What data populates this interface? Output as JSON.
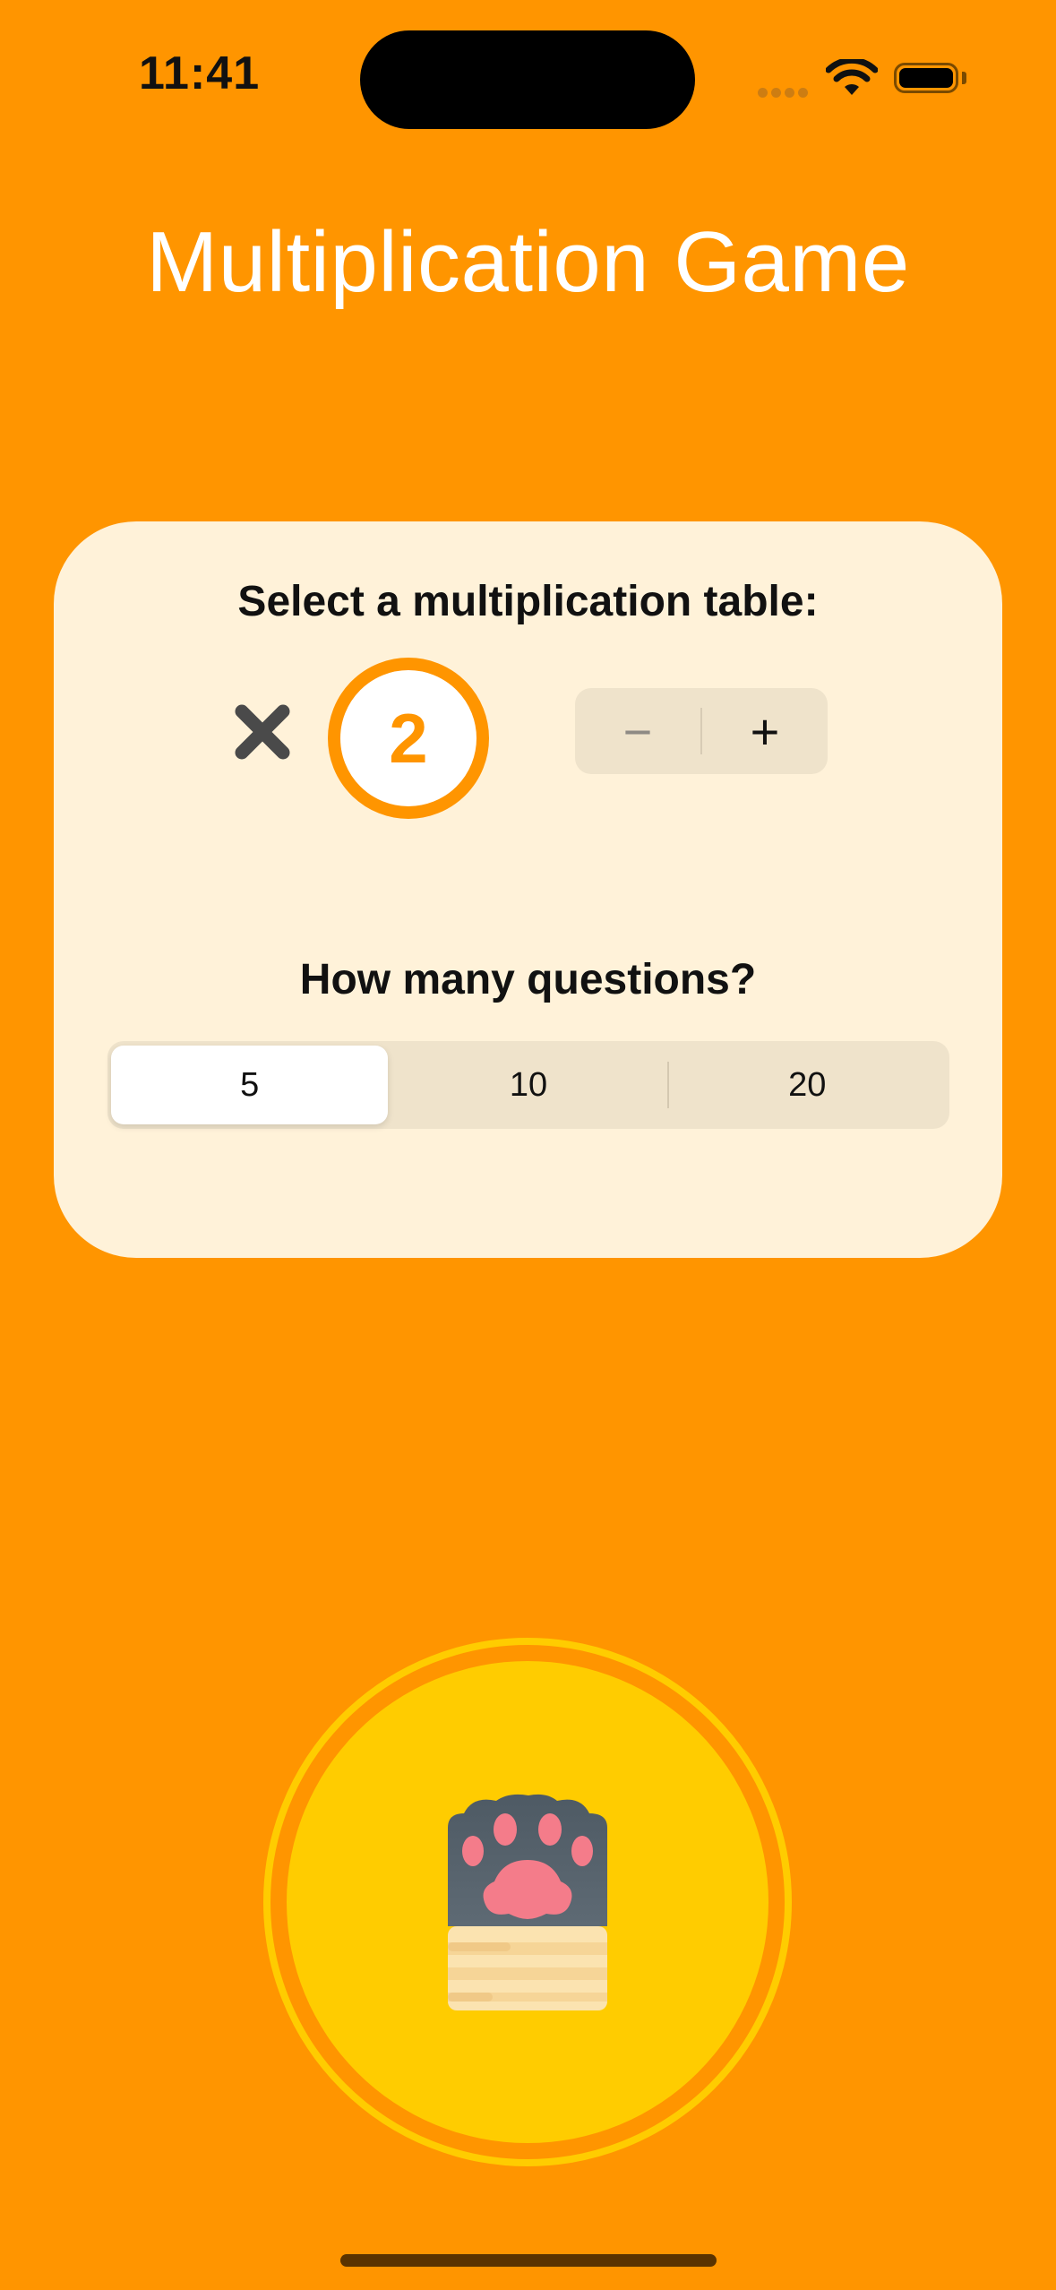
{
  "status_bar": {
    "time": "11:41"
  },
  "title": "Multiplication Game",
  "settings_card": {
    "table_prompt": "Select a multiplication table:",
    "times_symbol_icon": "multiply-icon",
    "selected_table": "2",
    "stepper": {
      "decrement_label": "−",
      "increment_label": "+"
    },
    "questions_prompt": "How many questions?",
    "question_options": [
      "5",
      "10",
      "20"
    ],
    "selected_question_option": "5"
  },
  "start_button": {
    "icon": "cat-paw-icon"
  },
  "colors": {
    "background": "#FF9500",
    "card": "#FFF2D9",
    "accent": "#FF9500",
    "start_button": "#FFCC00"
  }
}
